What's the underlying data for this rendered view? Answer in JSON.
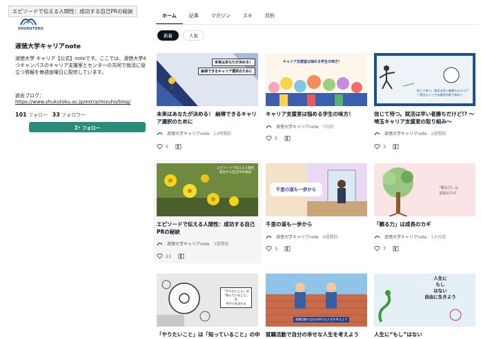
{
  "tooltip": "エピソードで伝える人間性：成功する自己PRの秘訣",
  "logo": {
    "text": "SHUKUTOKU"
  },
  "profile": {
    "name": "淑徳大学キャリアnote",
    "bio": "淑徳大学 キャリア【公式】noteです。ここでは、淑徳大学4つキャンパスのキャリア支援室とセンターの共同で就活に役立つ情報を毎週金曜日に配信しています。",
    "blog_label": "過去ブログ：",
    "blog_url": "https://www.shukutoku.ac.jp/extra/mizuho/blog/",
    "follows_count": "101",
    "follows_label": "フォロー",
    "followers_count": "33",
    "followers_label": "フォロワー",
    "follow_button": "フォロー"
  },
  "tabs": [
    "ホーム",
    "記事",
    "マガジン",
    "スキ",
    "月別"
  ],
  "chips": [
    "新着",
    "人気"
  ],
  "cards": [
    {
      "title": "未来はあなたが決める！ 納得できるキャリア選択のために",
      "author": "淑徳大学キャリアnote",
      "time": "14時間前",
      "likes": "5",
      "thumb_text": [
        "未来はあなたが決める！",
        "納得できるキャリア選択のために"
      ]
    },
    {
      "title": "キャリア支援室は悩める学生の味方！",
      "author": "淑徳大学キャリアnote",
      "time": "7日前",
      "likes": "5",
      "thumb_text": [
        "キャリア支援室は悩める学生の味方！"
      ]
    },
    {
      "title": "信じて待つ。就活は早い者勝ちだけど!? 〜埼玉キャリア支援室の取り組み〜",
      "author": "淑徳大学キャリアnote",
      "time": "2週間前",
      "likes": "3",
      "thumb_text": [
        "信じて待つ。就活は早い者勝ちだけど!?",
        "〜埼玉キャリア支援室の取り組み〜"
      ]
    },
    {
      "title": "エピソードで伝える人間性：成功する自己PRの秘訣",
      "author": "淑徳大学キャリアnote",
      "time": "3週間前",
      "likes": "21",
      "thumb_text": [
        "エピソードで伝える人間性",
        "成功する自己PRの秘訣"
      ]
    },
    {
      "title": "千里の道も一歩から",
      "author": "淑徳大学キャリアnote",
      "time": "4週間前",
      "likes": "3",
      "thumb_text": [
        "千里の道も一歩から"
      ]
    },
    {
      "title": "「頼る力」は成長のカギ",
      "author": "淑徳大学キャリアnote",
      "time": "1か月前",
      "likes": "7",
      "thumb_text": [
        "「頼る力」は",
        "成長のカギ"
      ]
    },
    {
      "title": "「やりたいこと」は「知っていること」の中",
      "thumb_text": [
        "「やりたいこと」は",
        "「知っていること」の",
        "中から生まれる"
      ]
    },
    {
      "title": "就職活動で自分の幸せな人生を考えよう",
      "thumb_text": [
        "就職活動で自分の幸せな人生を考えよう"
      ]
    },
    {
      "title": "人生に“もし”はない",
      "thumb_text": [
        "人生に",
        "もし",
        "はない",
        "自由に生きよう"
      ]
    }
  ],
  "colors": {
    "accent": "#2a8c7a",
    "text": "#08131a"
  }
}
